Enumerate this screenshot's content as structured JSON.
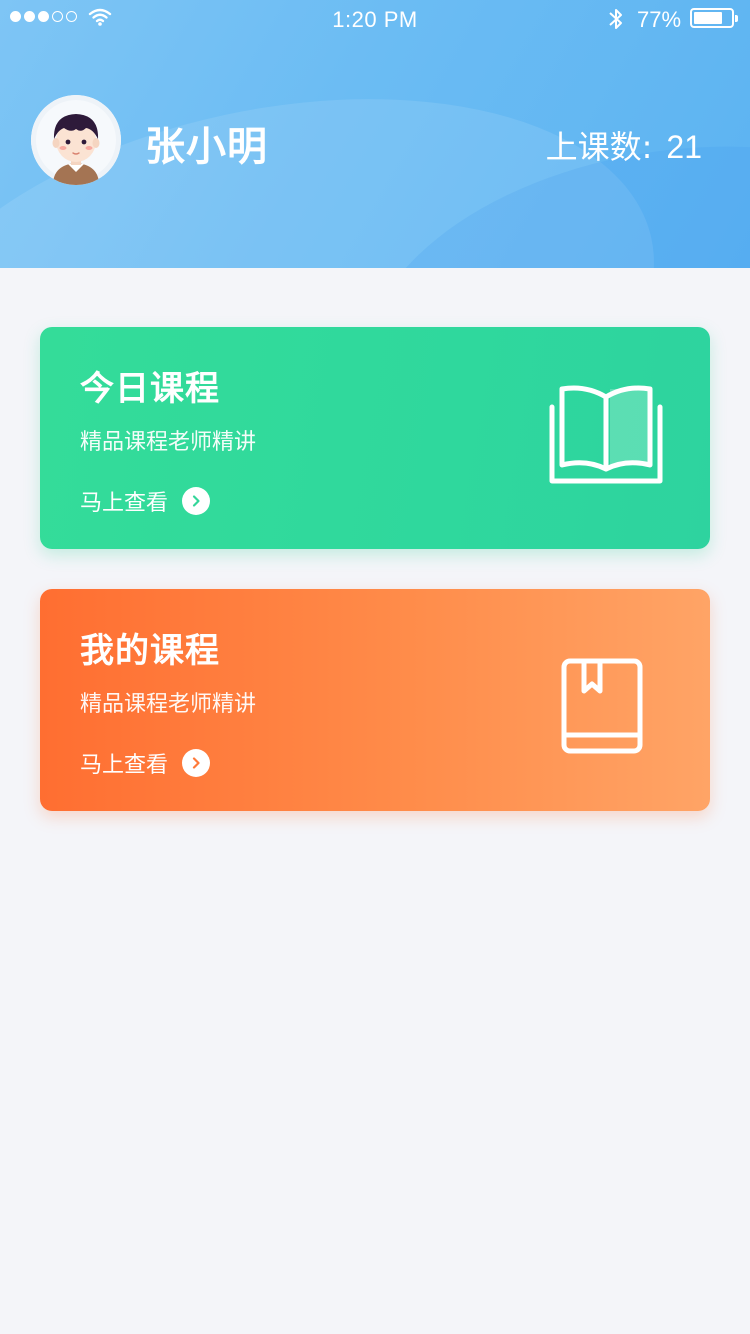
{
  "status_bar": {
    "time": "1:20 PM",
    "battery_percent": "77%",
    "battery_level": 0.77,
    "signal_strength": 3,
    "signal_total": 5
  },
  "profile": {
    "name": "张小明",
    "lesson_count_label": "上课数:",
    "lesson_count_value": "21"
  },
  "cards": [
    {
      "title": "今日课程",
      "subtitle": "精品课程老师精讲",
      "link_label": "马上查看",
      "icon": "open-book-icon",
      "color": "#34dc99"
    },
    {
      "title": "我的课程",
      "subtitle": "精品课程老师精讲",
      "link_label": "马上查看",
      "icon": "bookmarked-book-icon",
      "color": "#ff7a3a"
    }
  ]
}
